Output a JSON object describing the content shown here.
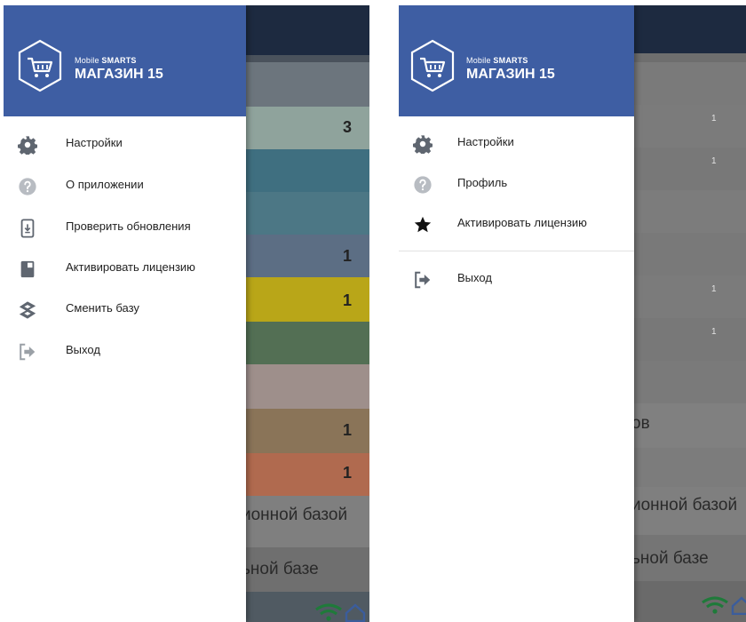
{
  "left_screen": {
    "brand_small_prefix": "Mobile ",
    "brand_small_strong": "SMARTS",
    "brand_title": "МАГАЗИН 15",
    "menu": [
      {
        "label": "Настройки",
        "icon": "gear-icon"
      },
      {
        "label": "О приложении",
        "icon": "help-icon"
      },
      {
        "label": "Проверить обновления",
        "icon": "phone-update-icon"
      },
      {
        "label": "Активировать лицензию",
        "icon": "license-card-icon"
      },
      {
        "label": "Сменить базу",
        "icon": "switch-base-icon"
      },
      {
        "label": "Выход",
        "icon": "exit-icon"
      }
    ],
    "background": {
      "counts": [
        "3",
        "1",
        "1",
        "1",
        "1"
      ],
      "texts": [
        "ионной базой",
        "ьной базе"
      ]
    }
  },
  "right_screen": {
    "brand_small_prefix": "Mobile ",
    "brand_small_strong": "SMARTS",
    "brand_title": "МАГАЗИН 15",
    "menu": [
      {
        "label": "Настройки",
        "icon": "gear-icon"
      },
      {
        "label": "Профиль",
        "icon": "help-icon"
      },
      {
        "label": "Активировать лицензию",
        "icon": "star-icon"
      }
    ],
    "exit_label": "Выход",
    "background": {
      "counts": [
        "1",
        "1",
        "1",
        "1"
      ],
      "texts": [
        "ов",
        "ионной базой",
        "ьной базе"
      ]
    }
  },
  "colors": {
    "header_blue": "#3e5ea3",
    "appbar_dark": "#1d2a40",
    "icon_gray": "#5f6670"
  }
}
